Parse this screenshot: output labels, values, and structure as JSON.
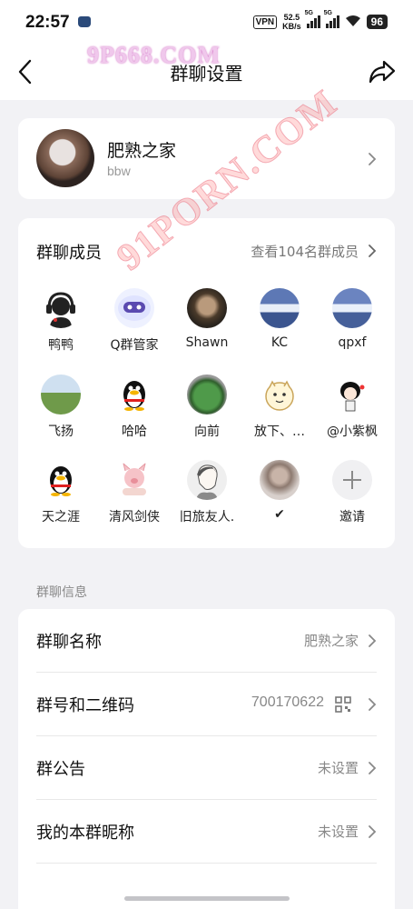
{
  "status_bar": {
    "time": "22:57",
    "vpn": "VPN",
    "speed": "52.5",
    "speed_unit": "KB/s",
    "net1": "5G",
    "net2": "5G",
    "battery": "96"
  },
  "nav": {
    "title": "群聊设置"
  },
  "watermark": {
    "top": "9P668.COM",
    "diagonal": "91PORN.COM"
  },
  "group": {
    "name": "肥熟之家",
    "subtitle": "bbw"
  },
  "members": {
    "title": "群聊成员",
    "view_all": "查看104名群成员",
    "list": [
      {
        "name": "鸭鸭",
        "avatar": "headset-avatar"
      },
      {
        "name": "Q群管家",
        "avatar": "robot-avatar"
      },
      {
        "name": "Shawn",
        "avatar": "photo-avatar"
      },
      {
        "name": "KC",
        "avatar": "landscape-avatar"
      },
      {
        "name": "qpxf",
        "avatar": "landscape-avatar"
      },
      {
        "name": "飞扬",
        "avatar": "field-avatar"
      },
      {
        "name": "哈哈",
        "avatar": "penguin-avatar"
      },
      {
        "name": "向前",
        "avatar": "frog-avatar"
      },
      {
        "name": "放下、…",
        "avatar": "cartoon-avatar"
      },
      {
        "name": "@小紫枫",
        "avatar": "cartoon-girl-avatar"
      },
      {
        "name": "天之涯",
        "avatar": "penguin-avatar"
      },
      {
        "name": "清风剑侠",
        "avatar": "pig-avatar"
      },
      {
        "name": "旧旅友人.",
        "avatar": "sketch-avatar"
      },
      {
        "name": "✔",
        "avatar": "photo-avatar"
      }
    ],
    "invite": "邀请"
  },
  "info": {
    "section": "群聊信息",
    "rows": [
      {
        "label": "群聊名称",
        "value": "肥熟之家"
      },
      {
        "label": "群号和二维码",
        "value": "700170622"
      },
      {
        "label": "群公告",
        "value": "未设置"
      },
      {
        "label": "我的本群昵称",
        "value": "未设置"
      }
    ]
  }
}
